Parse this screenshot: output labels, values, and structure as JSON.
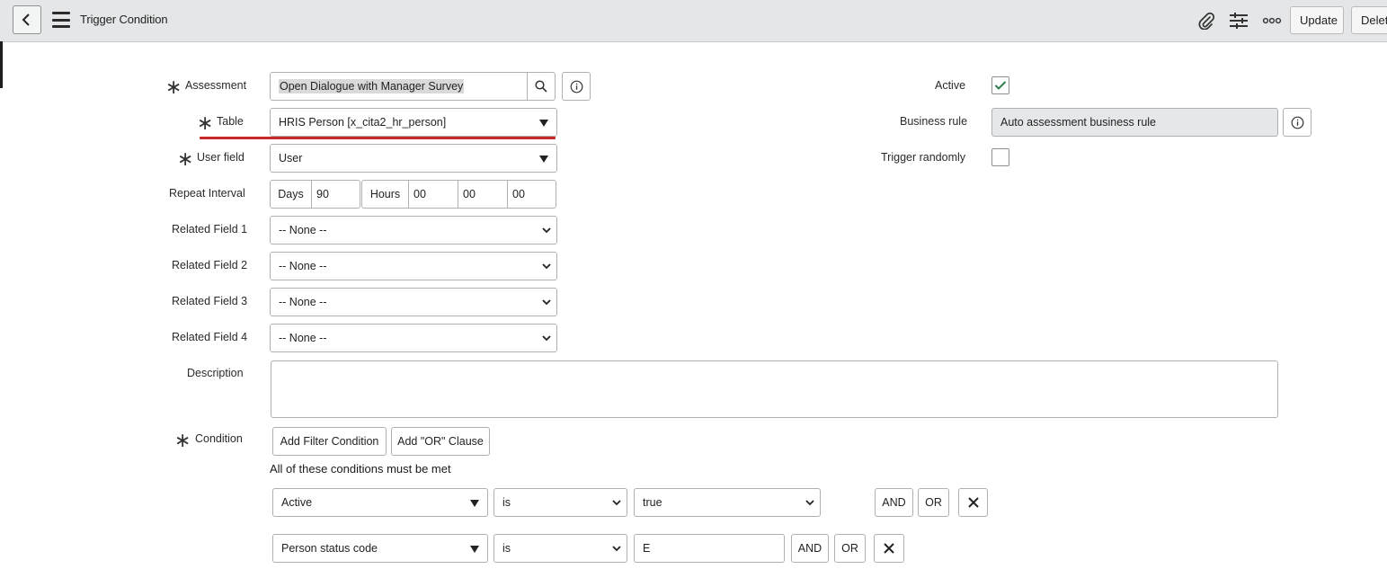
{
  "header": {
    "title": "Trigger Condition",
    "buttons": {
      "update": "Update",
      "delete": "Delete"
    },
    "icons": [
      "back-icon",
      "menu-icon",
      "attachment-icon",
      "settings-sliders-icon",
      "more-options-icon"
    ]
  },
  "form": {
    "assessment": {
      "label": "Assessment",
      "value": "Open Dialogue with Manager Survey"
    },
    "table": {
      "label": "Table",
      "value": "HRIS Person [x_cita2_hr_person]"
    },
    "user_field": {
      "label": "User field",
      "value": "User"
    },
    "repeat_interval": {
      "label": "Repeat Interval",
      "days_label": "Days",
      "days_value": "90",
      "hours_label": "Hours",
      "hours_value": "00",
      "minutes_value": "00",
      "seconds_value": "00"
    },
    "related_fields": [
      {
        "label": "Related Field 1",
        "value": "-- None --"
      },
      {
        "label": "Related Field 2",
        "value": "-- None --"
      },
      {
        "label": "Related Field 3",
        "value": "-- None --"
      },
      {
        "label": "Related Field 4",
        "value": "-- None --"
      }
    ],
    "description": {
      "label": "Description",
      "value": ""
    },
    "active": {
      "label": "Active",
      "checked": true
    },
    "business_rule": {
      "label": "Business rule",
      "value": "Auto assessment business rule"
    },
    "trigger_randomly": {
      "label": "Trigger randomly",
      "checked": false
    },
    "condition": {
      "label": "Condition",
      "add_filter_label": "Add Filter Condition",
      "add_or_label": "Add \"OR\" Clause",
      "note": "All of these conditions must be met",
      "rows": [
        {
          "field": "Active",
          "operator": "is",
          "value": "true",
          "and_label": "AND",
          "or_label": "OR"
        },
        {
          "field": "Person status code",
          "operator": "is",
          "value": "E",
          "and_label": "AND",
          "or_label": "OR"
        }
      ]
    }
  },
  "colors": {
    "header_bg": "#e4e6e7",
    "check_green": "#2e7d4f",
    "underline_red": "#c62828",
    "readonly_bg": "#e6e7e8"
  }
}
